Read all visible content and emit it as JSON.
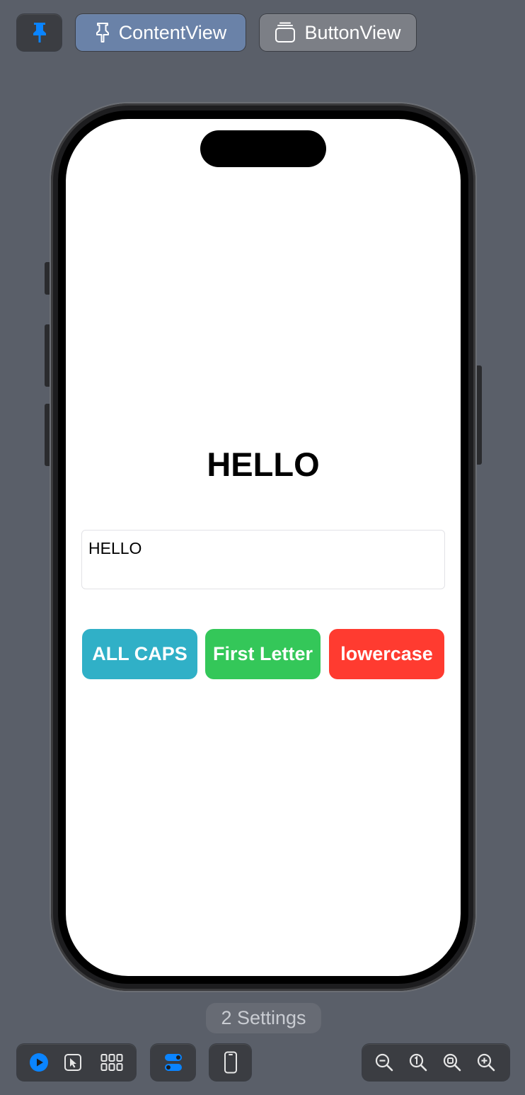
{
  "toolbar_top": {
    "pin_icon": "pin-filled-icon",
    "tabs": [
      {
        "label": "ContentView",
        "icon": "pin-outline-icon"
      },
      {
        "label": "ButtonView",
        "icon": "stack-icon"
      }
    ]
  },
  "app": {
    "title": "HELLO",
    "text_field_value": "HELLO",
    "buttons": [
      {
        "label": "ALL CAPS",
        "color": "#30b0c7"
      },
      {
        "label": "First Letter",
        "color": "#34c759"
      },
      {
        "label": "lowercase",
        "color": "#ff3b30"
      }
    ]
  },
  "settings_badge": "2 Settings",
  "toolbar_bottom": {
    "icons": [
      "play-icon",
      "select-cursor-icon",
      "grid-icon",
      "variants-toggle-icon",
      "device-icon",
      "zoom-out-icon",
      "zoom-actual-icon",
      "zoom-fit-icon",
      "zoom-in-icon"
    ]
  },
  "colors": {
    "background": "#5a5f69",
    "accent_blue": "#0a84ff",
    "active_tab": "#6a82a8"
  }
}
